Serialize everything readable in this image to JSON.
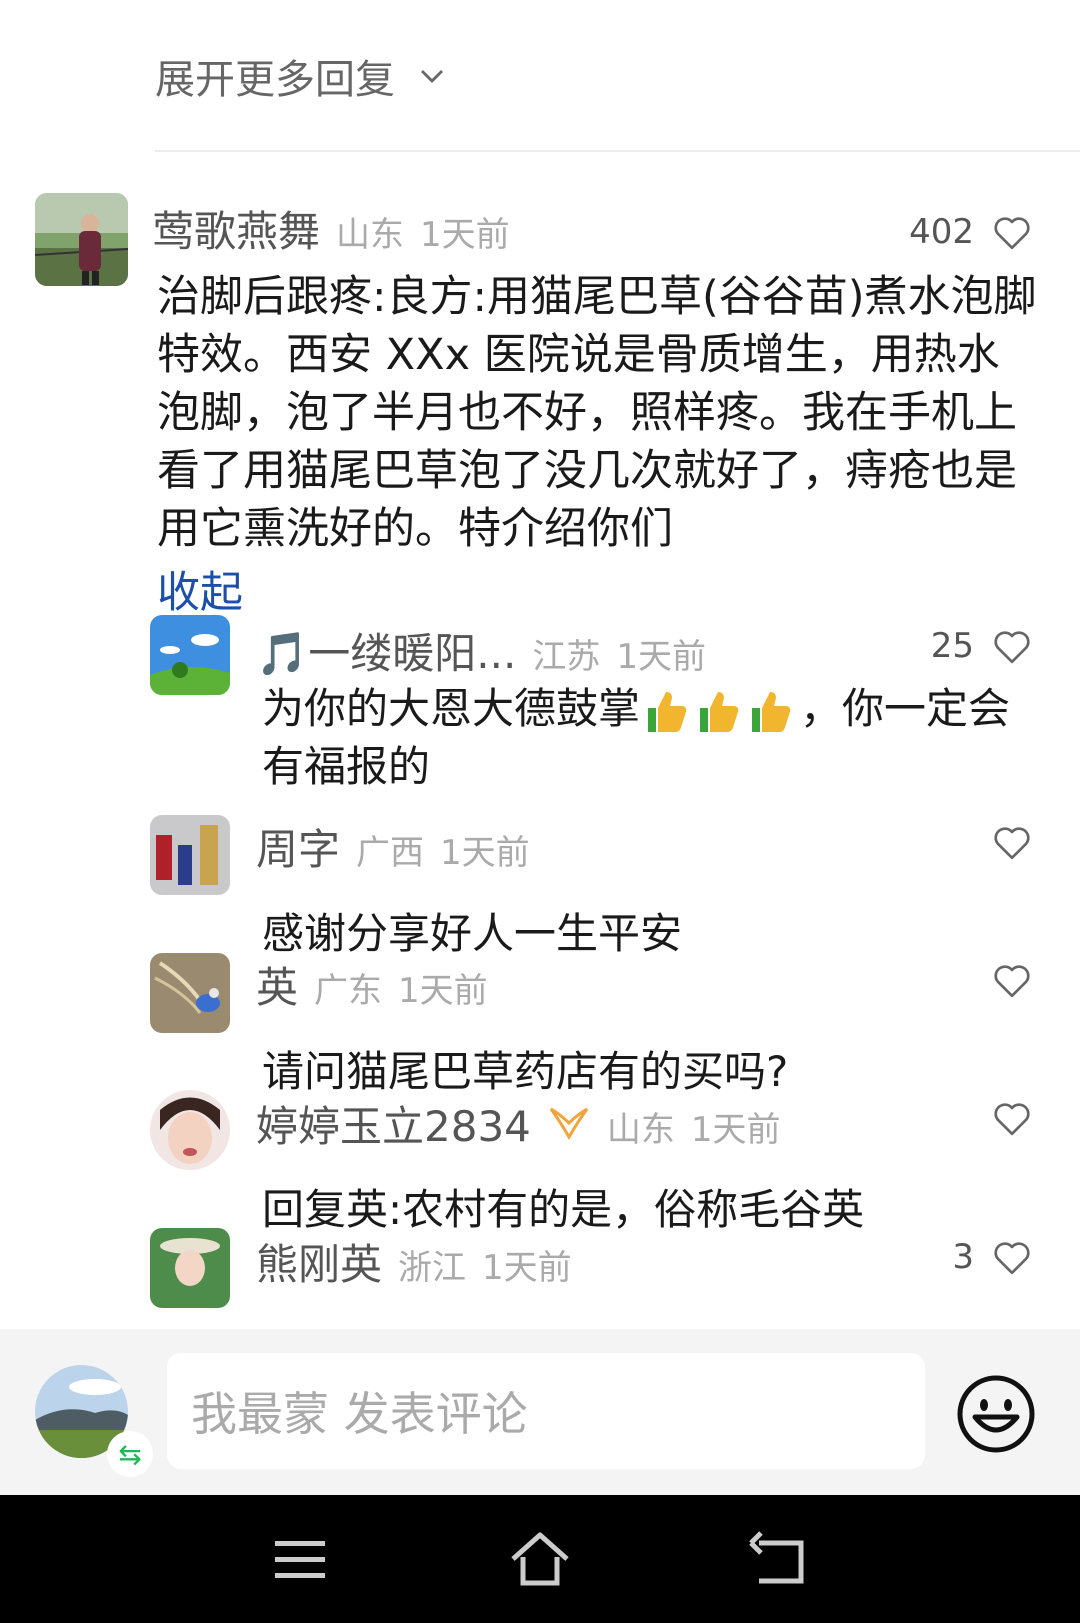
{
  "expand_more": {
    "label": "展开更多回复"
  },
  "main_comment": {
    "username": "莺歌燕舞",
    "location": "山东",
    "time": "1天前",
    "likes": "402",
    "text": "治脚后跟疼:良方:用猫尾巴草(谷谷苗)煮水泡脚特效。西安 XXx 医院说是骨质增生，用热水泡脚，泡了半月也不好，照样疼。我在手机上看了用猫尾巴草泡了没几次就好了，痔疮也是用它熏洗好的。特介绍你们",
    "collapse_label": "收起"
  },
  "replies": [
    {
      "username": "🎵一缕暖阳...",
      "location": "江苏",
      "time": "1天前",
      "likes": "25",
      "text_before": "为你的大恩大德鼓掌",
      "text_after": "，你一定会有福报的"
    },
    {
      "username": "周字",
      "location": "广西",
      "time": "1天前",
      "likes": "",
      "text": "感谢分享好人一生平安"
    },
    {
      "username": "英",
      "location": "广东",
      "time": "1天前",
      "likes": "",
      "text": "请问猫尾巴草药店有的买吗?"
    },
    {
      "username": "婷婷玉立2834",
      "location": "山东",
      "time": "1天前",
      "likes": "",
      "text": "回复英:农村有的是，俗称毛谷英"
    },
    {
      "username": "熊刚英",
      "location": "浙江",
      "time": "1天前",
      "likes": "3"
    }
  ],
  "comment_bar": {
    "placeholder": "我最蒙 发表评论"
  },
  "icons": {
    "like": "heart-outline-icon",
    "expand": "chevron-down-icon",
    "emoji": "smiley-icon",
    "nav_menu": "menu-icon",
    "nav_home": "home-icon",
    "nav_back": "back-icon",
    "swap": "swap-icon",
    "vip_badge": "vip-badge-icon",
    "thumbs_up": "thumbs-up-emoji"
  },
  "colors": {
    "link": "#1e4fa8",
    "meta": "#aaaaaa",
    "badge": "#f0a43a"
  }
}
